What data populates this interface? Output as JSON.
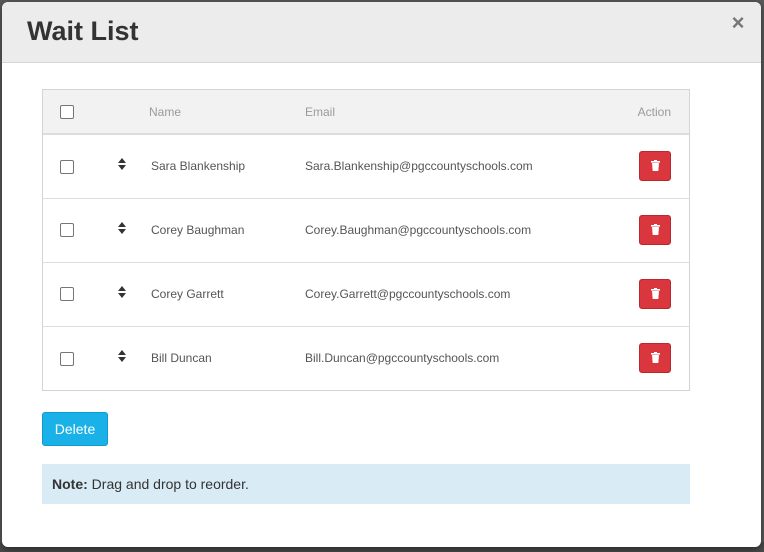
{
  "dialog": {
    "title": "Wait List",
    "close_label": "×"
  },
  "table": {
    "headers": {
      "name": "Name",
      "email": "Email",
      "action": "Action"
    },
    "rows": [
      {
        "name": "Sara Blankenship",
        "email": "Sara.Blankenship@pgccountyschools.com"
      },
      {
        "name": "Corey Baughman",
        "email": "Corey.Baughman@pgccountyschools.com"
      },
      {
        "name": "Corey Garrett",
        "email": "Corey.Garrett@pgccountyschools.com"
      },
      {
        "name": "Bill Duncan",
        "email": "Bill.Duncan@pgccountyschools.com"
      }
    ]
  },
  "actions": {
    "delete_label": "Delete"
  },
  "note": {
    "label": "Note:",
    "text": " Drag and drop to reorder."
  },
  "colors": {
    "primary": "#1ab1e8",
    "danger": "#d9363e",
    "note_bg": "#d9ebf5"
  },
  "icons": {
    "row_action": "trash-icon",
    "row_handle": "drag-handle-icon",
    "close": "close-icon"
  }
}
